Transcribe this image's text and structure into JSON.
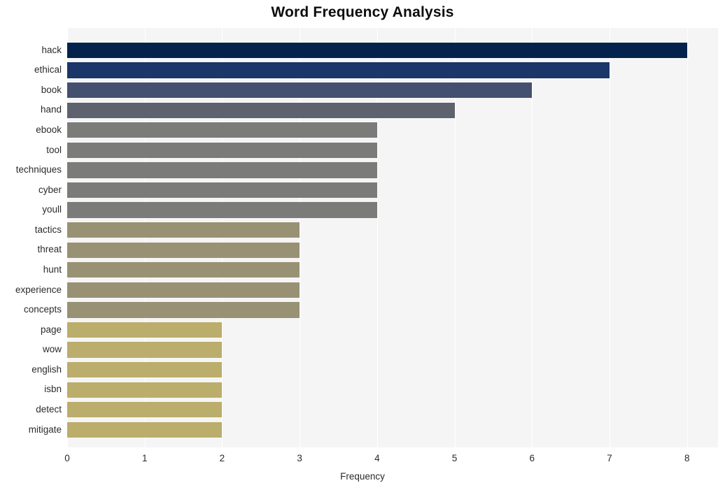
{
  "chart_data": {
    "type": "bar",
    "orientation": "horizontal",
    "title": "Word Frequency Analysis",
    "xlabel": "Frequency",
    "ylabel": "",
    "categories": [
      "hack",
      "ethical",
      "book",
      "hand",
      "ebook",
      "tool",
      "techniques",
      "cyber",
      "youll",
      "tactics",
      "threat",
      "hunt",
      "experience",
      "concepts",
      "page",
      "wow",
      "english",
      "isbn",
      "detect",
      "mitigate"
    ],
    "values": [
      8,
      7,
      6,
      5,
      4,
      4,
      4,
      4,
      4,
      3,
      3,
      3,
      3,
      3,
      2,
      2,
      2,
      2,
      2,
      2
    ],
    "bar_colors": [
      "#04234c",
      "#1b3668",
      "#454f70",
      "#5e626f",
      "#7b7b79",
      "#7b7b79",
      "#7b7b79",
      "#7b7b79",
      "#7b7b79",
      "#999174",
      "#999174",
      "#999174",
      "#999174",
      "#999174",
      "#bbad6b",
      "#bbad6b",
      "#bbad6b",
      "#bbad6b",
      "#bbad6b",
      "#bbad6b"
    ],
    "xlim": [
      0,
      8.4
    ],
    "xticks": [
      0,
      1,
      2,
      3,
      4,
      5,
      6,
      7,
      8
    ],
    "xtick_labels": [
      "0",
      "1",
      "2",
      "3",
      "4",
      "5",
      "6",
      "7",
      "8"
    ],
    "grid": true,
    "grid_axis": "x",
    "grid_color": "#ffffff",
    "plot_background": "#f5f5f6",
    "figure_background": "#ffffff",
    "legend": null,
    "legend_position": "none"
  }
}
